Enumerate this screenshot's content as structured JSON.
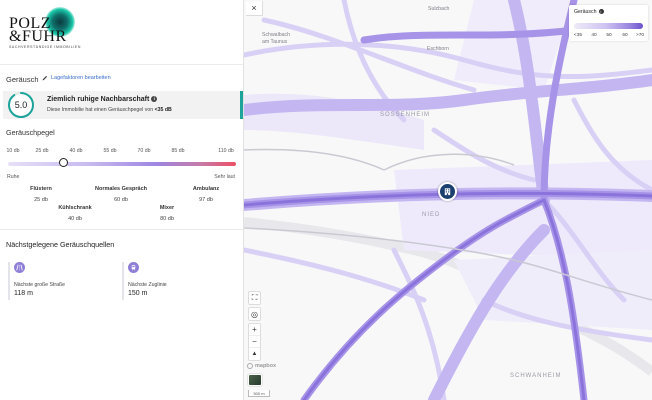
{
  "logo": {
    "line1": "POLZ",
    "line2": "&FUHR",
    "tagline": "SACHVERSTÄNDIGE IMMOBILIEN"
  },
  "panel": {
    "section_label": "Geräusch",
    "edit_link": "Lagefaktoren bearbeiten",
    "card": {
      "score": "5.0",
      "score_fraction": 0.9,
      "title": "Ziemlich ruhige Nachbarschaft",
      "description_prefix": "Diese Immobilie hat einen Geräuschpegel von",
      "description_value": "<35 dB"
    },
    "pegel_title": "Geräuschpegel",
    "ticks": [
      "10 db",
      "25 db",
      "40 db",
      "55 db",
      "70 db",
      "85 db",
      "110 db"
    ],
    "slider_value_db": 35,
    "scale_low": "Ruhe",
    "scale_high": "Sehr laut",
    "references": [
      {
        "name": "Flüstern",
        "db": "25 db"
      },
      {
        "name": "Kühlschrank",
        "db": "40 db"
      },
      {
        "name": "Normales Gespräch",
        "db": "60 db"
      },
      {
        "name": "Mixer",
        "db": "80 db"
      },
      {
        "name": "Ambulanz",
        "db": "97 db"
      }
    ],
    "sources_title": "Nächstgelegene Geräuschquellen",
    "sources": [
      {
        "icon": "road-icon",
        "label": "Nächste große Straße",
        "value": "118 m"
      },
      {
        "icon": "train-icon",
        "label": "Nächste Zuglinie",
        "value": "150 m"
      }
    ]
  },
  "map": {
    "close_label": "×",
    "legend": {
      "title": "Geräusch",
      "ticks": [
        "<35",
        "40",
        "50",
        "60",
        ">70"
      ]
    },
    "place_labels": {
      "schwalbach": "Schwalbach\nam Taunus",
      "eschborn": "Eschborn",
      "sulzbach": "Sulzbach",
      "soessenheim": "SOSSENHEIM",
      "nied": "NIED",
      "schwanheim": "SCHWANHEIM"
    },
    "controls": {
      "fullscreen": "⛶",
      "locate": "◎",
      "zoom_in": "+",
      "zoom_out": "−",
      "compass": "▲"
    },
    "attribution": "mapbox",
    "scale_label": "500 m",
    "colors": {
      "noise_light": "#e4def8",
      "noise_mid": "#c5b8f1",
      "noise_strong": "#8d76dd",
      "marker": "#1b3f6e"
    }
  }
}
